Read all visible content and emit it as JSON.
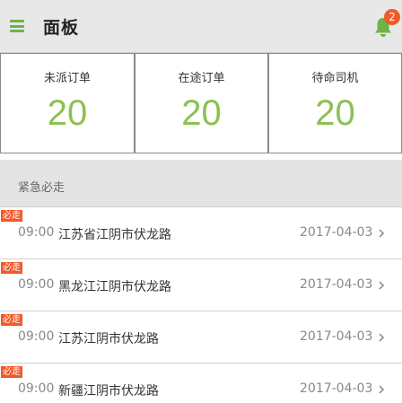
{
  "header": {
    "title": "面板",
    "menu_icon": "hamburger-menu-icon",
    "bell_icon": "bell-icon",
    "notification_count": "2",
    "accent_color": "#6fb248",
    "badge_color": "#f0592a"
  },
  "stats": [
    {
      "label": "未派订单",
      "value": "20"
    },
    {
      "label": "在途订单",
      "value": "20"
    },
    {
      "label": "待命司机",
      "value": "20"
    }
  ],
  "stat_value_color": "#8cc152",
  "section": {
    "title": "紧急必走"
  },
  "orders": [
    {
      "tag": "必走",
      "time": "09:00",
      "address": "江苏省江阴市伏龙路",
      "date": "2017-04-03"
    },
    {
      "tag": "必走",
      "time": "09:00",
      "address": "黑龙江江阴市伏龙路",
      "date": "2017-04-03"
    },
    {
      "tag": "必走",
      "time": "09:00",
      "address": "江苏江阴市伏龙路",
      "date": "2017-04-03"
    },
    {
      "tag": "必走",
      "time": "09:00",
      "address": "新疆江阴市伏龙路",
      "date": "2017-04-03"
    }
  ],
  "row_chevron_icon": "chevron-right-icon"
}
